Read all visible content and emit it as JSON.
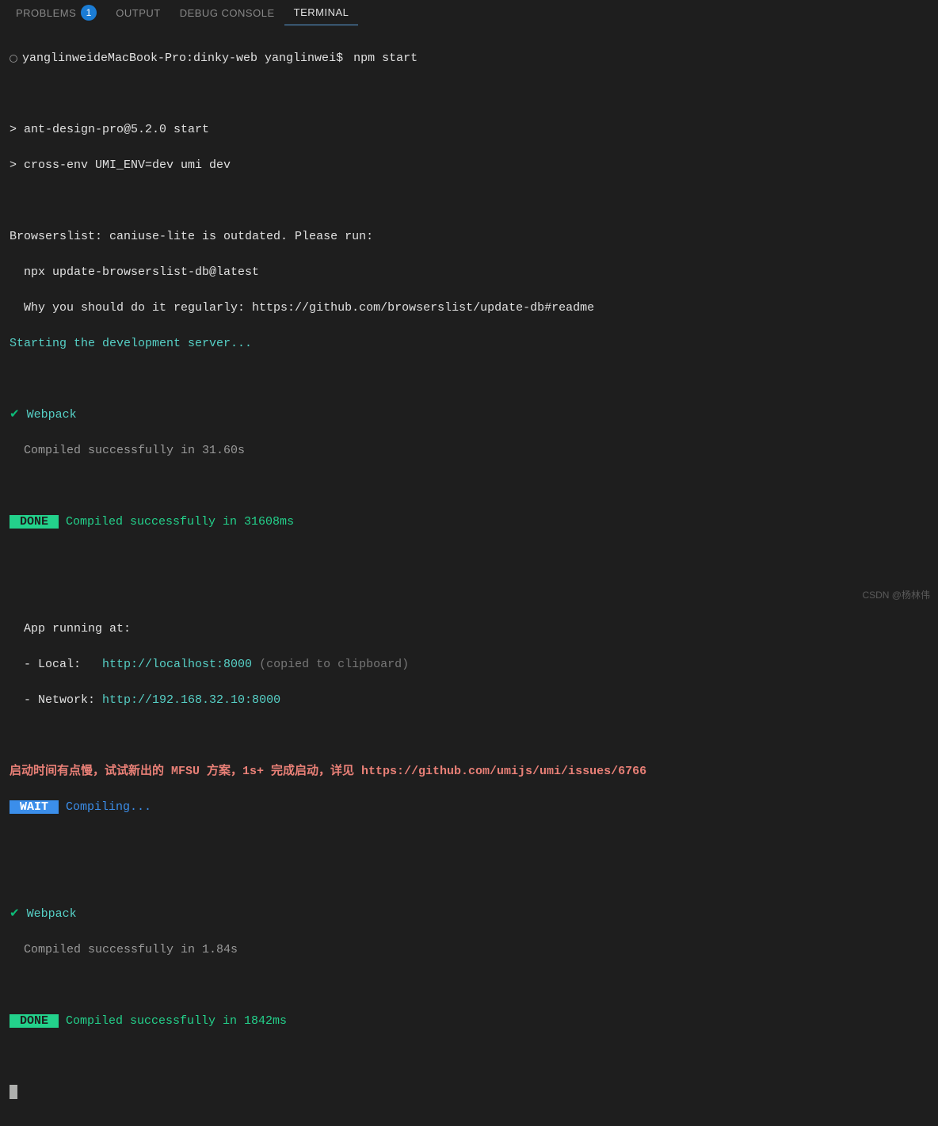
{
  "tabs": {
    "problems": {
      "label": "PROBLEMS",
      "badge": "1"
    },
    "output": {
      "label": "OUTPUT"
    },
    "debug": {
      "label": "DEBUG CONSOLE"
    },
    "terminal": {
      "label": "TERMINAL"
    }
  },
  "terminal": {
    "prompt": "yanglinweideMacBook-Pro:dinky-web yanglinwei$ ",
    "command": "npm start",
    "script1": "> ant-design-pro@5.2.0 start",
    "script2": "> cross-env UMI_ENV=dev umi dev",
    "browserslist1": "Browserslist: caniuse-lite is outdated. Please run:",
    "browserslist2": "  npx update-browserslist-db@latest",
    "browserslist3": "  Why you should do it regularly: https://github.com/browserslist/update-db#readme",
    "starting": "Starting the development server...",
    "check": "✔",
    "webpack1": " Webpack",
    "compiled1": "  Compiled successfully in 31.60s",
    "doneBadge": " DONE ",
    "doneMsg1": " Compiled successfully in 31608ms",
    "appRunning": "  App running at:",
    "localLabel": "  - Local:   ",
    "localUrl": "http://localhost:8000",
    "localCopied": " (copied to clipboard)",
    "networkLabel": "  - Network: ",
    "networkUrl": "http://192.168.32.10:8000",
    "mfsu": "启动时间有点慢，试试新出的 MFSU 方案，1s+ 完成启动，详见 https://github.com/umijs/umi/issues/6766",
    "waitBadge": " WAIT ",
    "compiling": " Compiling...",
    "webpack2": " Webpack",
    "compiled2": "  Compiled successfully in 1.84s",
    "doneMsg2": " Compiled successfully in 1842ms"
  },
  "watermark": "CSDN @杨林伟"
}
